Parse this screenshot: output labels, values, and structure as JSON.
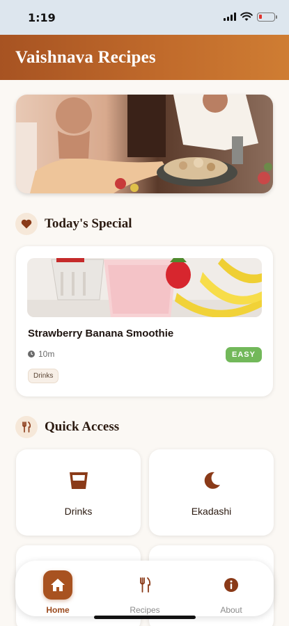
{
  "status_bar": {
    "time": "1:19"
  },
  "header": {
    "title": "Vaishnava Recipes"
  },
  "todays_special": {
    "section_title": "Today's Special",
    "recipe": {
      "name": "Strawberry Banana Smoothie",
      "time": "10m",
      "difficulty": "EASY",
      "tag": "Drinks"
    }
  },
  "quick_access": {
    "section_title": "Quick Access",
    "items": [
      {
        "label": "Drinks",
        "icon": "cup-icon"
      },
      {
        "label": "Ekadashi",
        "icon": "moon-icon"
      }
    ]
  },
  "bottom_nav": {
    "items": [
      {
        "label": "Home",
        "icon": "home-icon",
        "active": true
      },
      {
        "label": "Recipes",
        "icon": "utensils-icon",
        "active": false
      },
      {
        "label": "About",
        "icon": "info-icon",
        "active": false
      }
    ]
  },
  "colors": {
    "brand": "#a85220",
    "header_gradient_start": "#a75322",
    "header_gradient_end": "#cf7d33",
    "easy_badge": "#72b85a"
  }
}
